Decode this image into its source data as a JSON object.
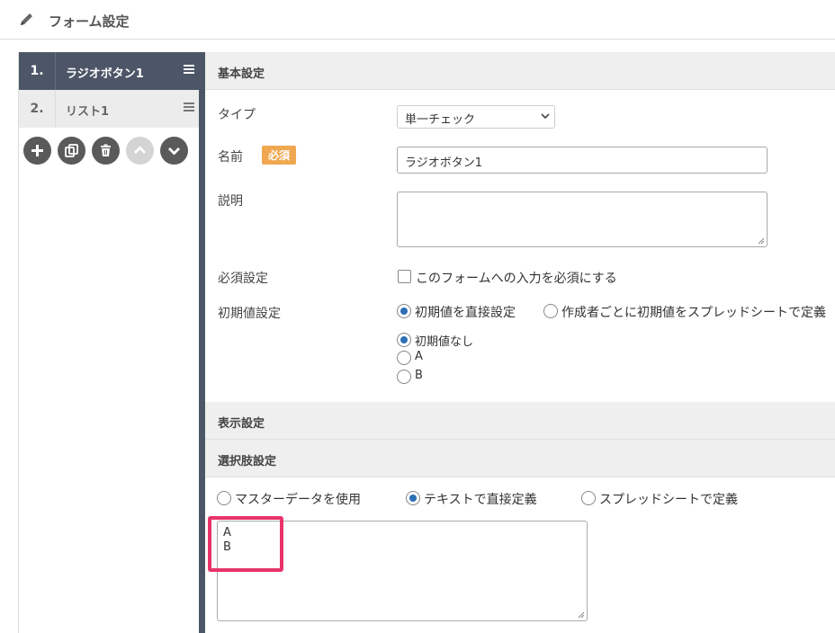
{
  "header": {
    "title": "フォーム設定",
    "icon": "pencil-icon"
  },
  "sidebar": {
    "items": [
      {
        "number": "1.",
        "label": "ラジオボタン1",
        "active": true
      },
      {
        "number": "2.",
        "label": "リスト1",
        "active": false
      }
    ],
    "tools": [
      {
        "name": "add-icon"
      },
      {
        "name": "copy-icon"
      },
      {
        "name": "trash-icon"
      },
      {
        "name": "chevron-up-icon",
        "disabled": true
      },
      {
        "name": "chevron-down-icon"
      }
    ]
  },
  "basic": {
    "header": "基本設定",
    "type_label": "タイプ",
    "type_value": "単一チェック",
    "name_label": "名前",
    "required_badge": "必須",
    "name_value": "ラジオボタン1",
    "desc_label": "説明",
    "desc_value": "",
    "required_label": "必須設定",
    "required_checkbox_text": "このフォームへの入力を必須にする",
    "initial_label": "初期値設定",
    "initial_options": [
      "初期値を直接設定",
      "作成者ごとに初期値をスプレッドシートで定義"
    ],
    "initial_values": [
      "初期値なし",
      "A",
      "B"
    ]
  },
  "display": {
    "header": "表示設定"
  },
  "choices": {
    "header": "選択肢設定",
    "source_options": [
      "マスターデータを使用",
      "テキストで直接定義",
      "スプレッドシートで定義"
    ],
    "text_lines": [
      "A",
      "B"
    ]
  },
  "colors": {
    "sidebar_dark": "#4c5667",
    "badge": "#f0a850",
    "highlight": "#e8336b",
    "radio": "#2c6fb5"
  }
}
